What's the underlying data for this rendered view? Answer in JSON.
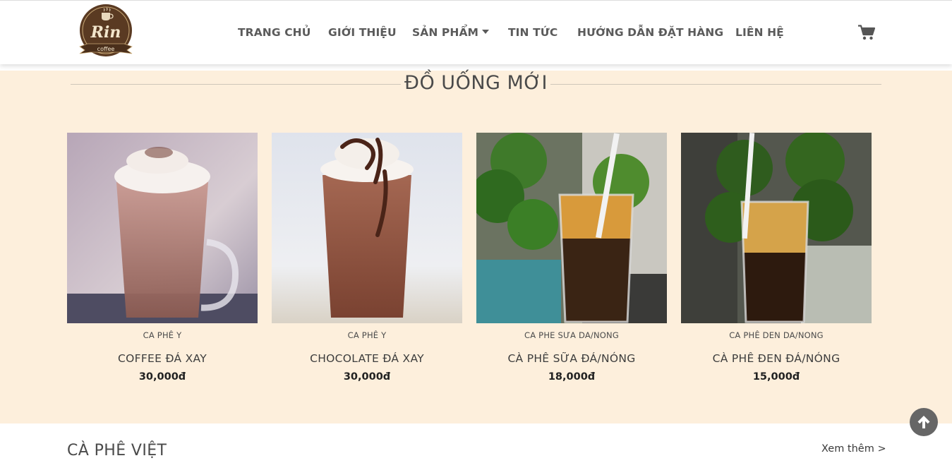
{
  "header": {
    "logo_text": "Rin",
    "logo_sub": "coffee",
    "nav": [
      {
        "label": "TRANG CHỦ"
      },
      {
        "label": "GIỚI THIỆU"
      },
      {
        "label": "SẢN PHẨM"
      },
      {
        "label": "TIN TỨC"
      },
      {
        "label": "HƯỚNG DẪN ĐẶT HÀNG"
      },
      {
        "label": "LIÊN HỆ"
      }
    ],
    "cart_icon": "shopping-cart-icon"
  },
  "new_drinks": {
    "title": "ĐỒ UỐNG MỚI",
    "products": [
      {
        "category": "CA PHÊ Y",
        "name": "COFFEE ĐÁ XAY",
        "price": "30,000đ"
      },
      {
        "category": "CA PHÊ Y",
        "name": "CHOCOLATE ĐÁ XAY",
        "price": "30,000đ"
      },
      {
        "category": "CA PHE SƯA DA/NONG",
        "name": "CÀ PHÊ SỮA ĐÁ/NÓNG",
        "price": "18,000đ"
      },
      {
        "category": "CA PHÊ DEN DA/NONG",
        "name": "CÀ PHÊ ĐEN ĐÁ/NÓNG",
        "price": "15,000đ"
      }
    ]
  },
  "viet_section": {
    "title": "CÀ PHÊ VIỆT",
    "more_link": "Xem thêm >"
  },
  "scroll_top_icon": "arrow-up-icon",
  "colors": {
    "section_bg": "#fdefdc",
    "nav_text": "#5b5b5b",
    "logo_brown": "#5a3a22",
    "scroll_button": "#666666"
  }
}
